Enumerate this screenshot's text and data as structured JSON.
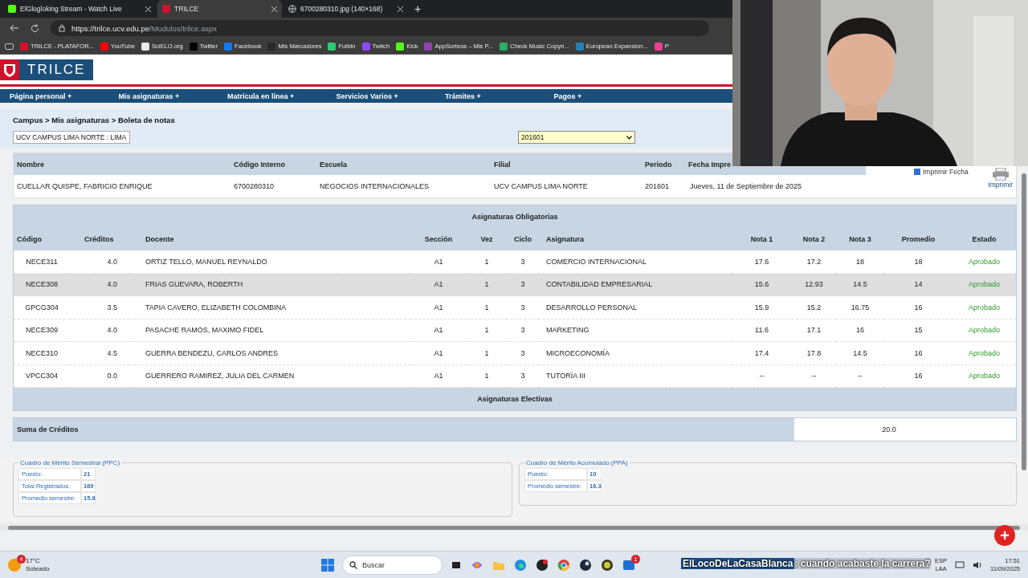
{
  "browser": {
    "tabs": [
      {
        "title": "ElGlogloking Stream - Watch Live",
        "kind": "favicon",
        "color": "#53fc18",
        "selected": false
      },
      {
        "title": "TRILCE",
        "kind": "favicon",
        "color": "#d0112b",
        "selected": true
      },
      {
        "title": "6700280310.jpg (140×168)",
        "kind": "globe",
        "selected": false
      }
    ],
    "new_tab": "+",
    "url_host": "https://trilce.ucv.edu.pe",
    "url_path": "/Modulos/trilce.aspx",
    "bookmarks": [
      {
        "label": "TRILCE - PLATAFOR...",
        "color": "#d0112b"
      },
      {
        "label": "YouTube",
        "color": "#ff0000"
      },
      {
        "label": "SciELO.org",
        "color": "#e8e8e8"
      },
      {
        "label": "Twitter",
        "color": "#000000"
      },
      {
        "label": "Facebook",
        "color": "#1877f2"
      },
      {
        "label": "Mis Marcadores",
        "color": "#2a2a2a"
      },
      {
        "label": "Futbin",
        "color": "#2ecc71"
      },
      {
        "label": "Twitch",
        "color": "#9146ff"
      },
      {
        "label": "Kick",
        "color": "#53fc18"
      },
      {
        "label": "AppSorteos – Mis P...",
        "color": "#8e44ad"
      },
      {
        "label": "Check Music Copyri...",
        "color": "#27ae60"
      },
      {
        "label": "European Expansion...",
        "color": "#2980b9"
      },
      {
        "label": "P",
        "color": "#e84393"
      }
    ]
  },
  "page": {
    "logo": "TRILCE",
    "nav": [
      "Página personal +",
      "Mis asignaturas +",
      "Matrícula en línea +",
      "Servicios Varios +",
      "Trámites +",
      "Pagos +"
    ],
    "breadcrumb": "Campus > Mis asignaturas > Boleta de notas",
    "campus_select": "UCV CAMPUS LIMA NORTE : LIMA",
    "period_select": "201601",
    "student": {
      "columns": [
        "Nombre",
        "Código Interno",
        "Escuela",
        "Filial",
        "Periodo",
        "Fecha Impre"
      ],
      "values": [
        "CUELLAR QUISPE, FABRICIO ENRIQUE",
        "6700280310",
        "NEGOCIOS INTERNACIONALES",
        "UCV CAMPUS LIMA NORTE",
        "201601",
        "Jueves, 11 de Septiembre de 2025"
      ]
    },
    "print_date": {
      "label": "Imprimir Fecha",
      "checked": true
    },
    "print_button": "Imprimir",
    "grades": {
      "title": "Asignaturas Obligatorias",
      "columns": [
        "Código",
        "Créditos",
        "Docente",
        "Sección",
        "Vez",
        "Ciclo",
        "Asignatura",
        "Nota 1",
        "Nota 2",
        "Nota 3",
        "Promedio",
        "Estado"
      ],
      "rows": [
        {
          "cells": [
            "NECE311",
            "4.0",
            "ORTIZ TELLO, MANUEL REYNALDO",
            "A1",
            "1",
            "3",
            "COMERCIO INTERNACIONAL",
            "17.6",
            "17.2",
            "18",
            "18",
            "Aprobado"
          ],
          "selected": false
        },
        {
          "cells": [
            "NECE308",
            "4.0",
            "FRIAS GUEVARA, ROBERTH",
            "A1",
            "1",
            "3",
            "CONTABILIDAD EMPRESARIAL",
            "15.6",
            "12.93",
            "14.5",
            "14",
            "Aprobado"
          ],
          "selected": true
        },
        {
          "cells": [
            "GPCG304",
            "3.5",
            "TAPIA CAVERO, ELIZABETH COLOMBINA",
            "A1",
            "1",
            "3",
            "DESARROLLO PERSONAL",
            "15.9",
            "15.2",
            "16.75",
            "16",
            "Aprobado"
          ],
          "selected": false
        },
        {
          "cells": [
            "NECE309",
            "4.0",
            "PASACHE RAMOS, MAXIMO FIDEL",
            "A1",
            "1",
            "3",
            "MARKETING",
            "11.6",
            "17.1",
            "16",
            "15",
            "Aprobado"
          ],
          "selected": false
        },
        {
          "cells": [
            "NECE310",
            "4.5",
            "GUERRA BENDEZU, CARLOS ANDRES",
            "A1",
            "1",
            "3",
            "MICROECONOMÍA",
            "17.4",
            "17.8",
            "14.5",
            "16",
            "Aprobado"
          ],
          "selected": false
        },
        {
          "cells": [
            "VPCC304",
            "0.0",
            "GUERRERO RAMIREZ, JULIA DEL CARMEN",
            "A1",
            "1",
            "3",
            "TUTORÍA III",
            "--",
            "--",
            "--",
            "16",
            "Aprobado"
          ],
          "selected": false
        }
      ],
      "electives_title": "Asignaturas Electivas",
      "credits_label": "Suma de Créditos",
      "credits_value": "20.0"
    },
    "merit": [
      {
        "legend": "Cuadro de Mérito Semestral (PPC)",
        "rows": [
          [
            "Puesto:",
            "21"
          ],
          [
            "Total Registrados:",
            "169"
          ],
          [
            "Promedio semestre:",
            "15.8"
          ]
        ]
      },
      {
        "legend": "Cuadro de Mérito Acumulado (PPA)",
        "rows": [
          [
            "Puesto:",
            "10"
          ],
          [
            "Promedio semestre:",
            "16.3"
          ]
        ]
      }
    ],
    "fab": "+"
  },
  "taskbar": {
    "weather_badge": "4",
    "temperature": "17°C",
    "condition": "Soleado",
    "search_placeholder": "Buscar",
    "apps": [
      {
        "kind": "taskview"
      },
      {
        "kind": "copilot"
      },
      {
        "kind": "folder"
      },
      {
        "kind": "edge"
      },
      {
        "kind": "app"
      },
      {
        "kind": "chrome"
      },
      {
        "kind": "steam"
      },
      {
        "kind": "generic"
      },
      {
        "kind": "store",
        "badge": "1"
      }
    ],
    "chat_user": "ElLocoDeLaCasaBlanca",
    "chat_message": ": cuando acabaste la carrera?",
    "language": "ESP",
    "layout": "LAA",
    "time": "17:51",
    "date": "11/09/2025"
  }
}
